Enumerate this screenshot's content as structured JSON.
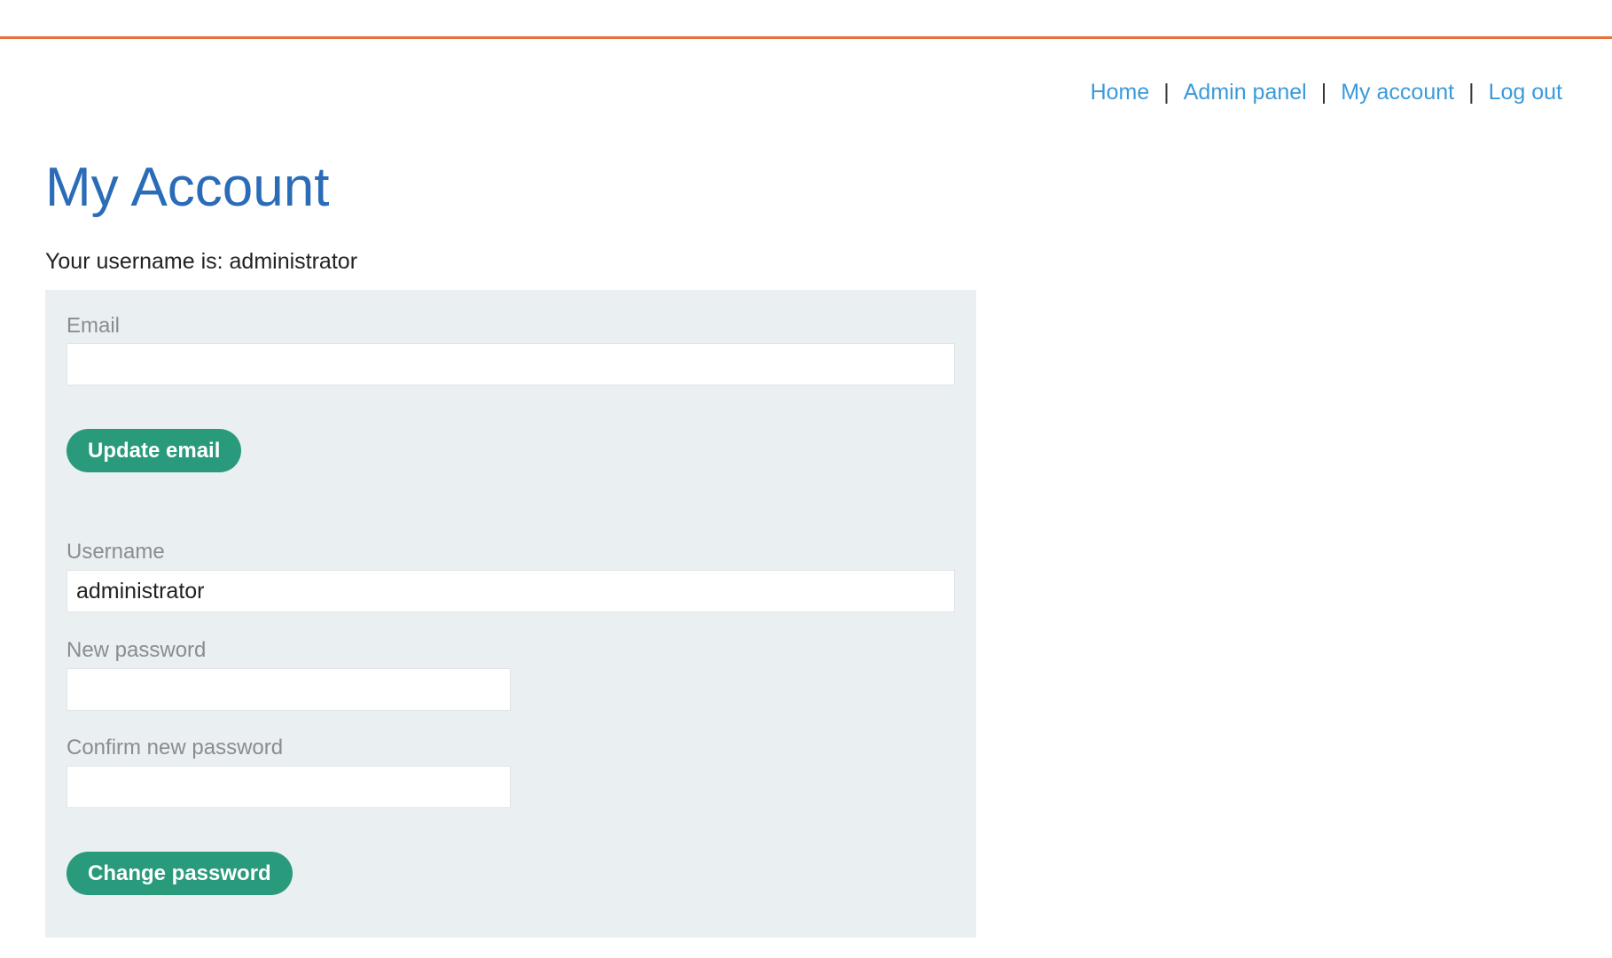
{
  "nav": {
    "items": [
      "Home",
      "Admin panel",
      "My account",
      "Log out"
    ],
    "separator": "|"
  },
  "page": {
    "title": "My Account",
    "username_line": "Your username is: administrator"
  },
  "email_form": {
    "label": "Email",
    "value": "",
    "button": "Update email"
  },
  "password_form": {
    "username_label": "Username",
    "username_value": "administrator",
    "new_password_label": "New password",
    "new_password_value": "",
    "confirm_password_label": "Confirm new password",
    "confirm_password_value": "",
    "button": "Change password"
  },
  "colors": {
    "accent_rule": "#e8703a",
    "title": "#2b6cb8",
    "link": "#3b9ad9",
    "button": "#2a9a7c",
    "panel": "#eaeff2"
  }
}
